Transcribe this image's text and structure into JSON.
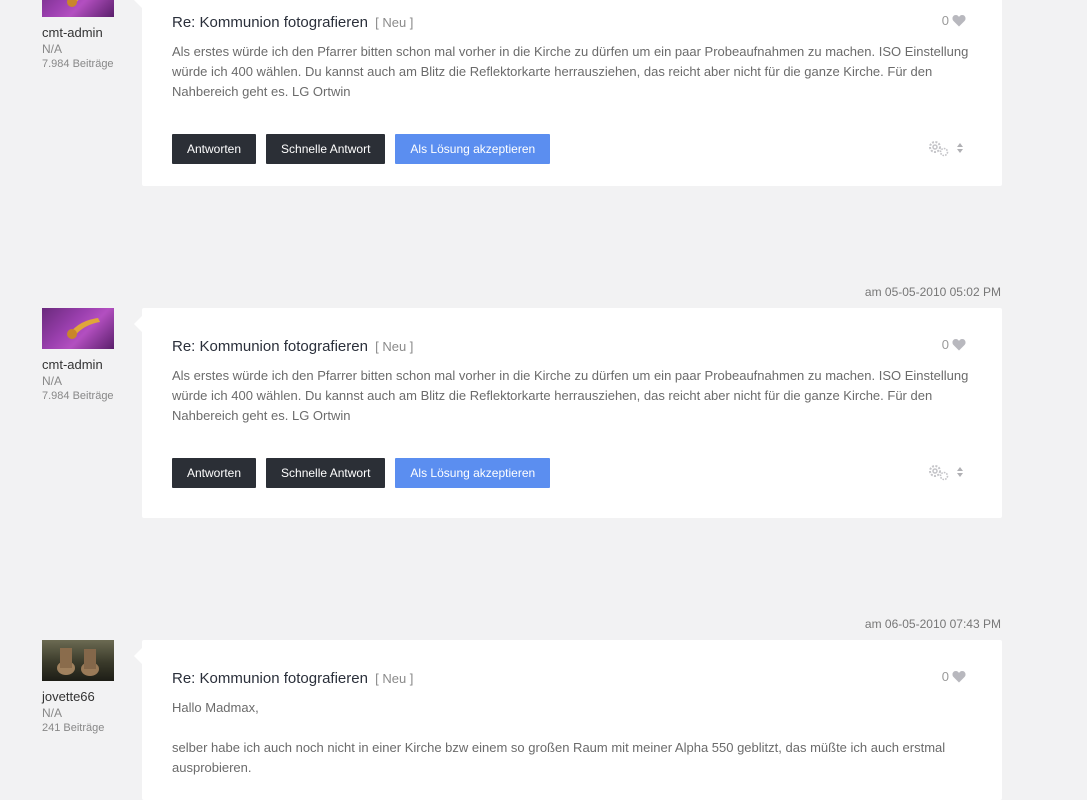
{
  "posts": [
    {
      "date": "",
      "user": {
        "name": "cmt-admin",
        "rank": "N/A",
        "count": "7.984 Beiträge"
      },
      "title": "Re: Kommunion fotografieren",
      "badge": "[ Neu ]",
      "kudos": "0",
      "paragraphs": [
        "Als erstes würde ich den Pfarrer bitten schon mal vorher in die Kirche zu dürfen um ein paar Probeaufnahmen zu machen. ISO Einstellung würde ich 400 wählen. Du kannst auch am Blitz die Reflektorkarte herrausziehen, das reicht aber nicht für die ganze Kirche. Für den Nahbereich geht es. LG Ortwin"
      ],
      "buttons": {
        "reply": "Antworten",
        "quick_reply": "Schnelle Antwort",
        "accept": "Als Lösung akzeptieren"
      }
    },
    {
      "date": "am 05-05-2010 05:02 PM",
      "user": {
        "name": "cmt-admin",
        "rank": "N/A",
        "count": "7.984 Beiträge"
      },
      "title": "Re: Kommunion fotografieren",
      "badge": "[ Neu ]",
      "kudos": "0",
      "paragraphs": [
        "Als erstes würde ich den Pfarrer bitten schon mal vorher in die Kirche zu dürfen um ein paar Probeaufnahmen zu machen. ISO Einstellung würde ich 400 wählen. Du kannst auch am Blitz die Reflektorkarte herrausziehen, das reicht aber nicht für die ganze Kirche. Für den Nahbereich geht es. LG Ortwin"
      ],
      "buttons": {
        "reply": "Antworten",
        "quick_reply": "Schnelle Antwort",
        "accept": "Als Lösung akzeptieren"
      }
    },
    {
      "date": "am 06-05-2010 07:43 PM",
      "user": {
        "name": "jovette66",
        "rank": "N/A",
        "count": "241 Beiträge"
      },
      "title": "Re: Kommunion fotografieren",
      "badge": "[ Neu ]",
      "kudos": "0",
      "paragraphs": [
        "Hallo Madmax,",
        "selber habe ich auch noch nicht in einer Kirche bzw einem so großen Raum mit meiner Alpha 550 geblitzt, das müßte ich auch erstmal ausprobieren."
      ]
    }
  ],
  "colors": {
    "accept_button": "#5b8ef0",
    "dark_button": "#2b2f36",
    "background": "#f2f2f3"
  }
}
